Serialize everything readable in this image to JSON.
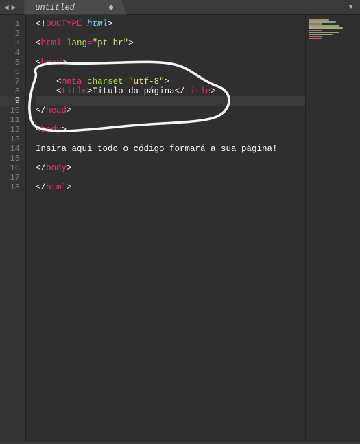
{
  "tab": {
    "title": "untitled",
    "dirty": true
  },
  "nav": {
    "back": "◀",
    "forward": "▶",
    "menu": "▼"
  },
  "gutter_lines": [
    "1",
    "2",
    "3",
    "4",
    "5",
    "6",
    "7",
    "8",
    "9",
    "10",
    "11",
    "12",
    "13",
    "14",
    "15",
    "16",
    "17",
    "18"
  ],
  "code": {
    "l1": {
      "a": "<!",
      "b": "DOCTYPE",
      "c": " ",
      "d": "html",
      "e": ">"
    },
    "l3": {
      "a": "<",
      "b": "html",
      "c": " ",
      "d": "lang",
      "e": "=",
      "f": "\"pt-br\"",
      "g": ">"
    },
    "l5": {
      "a": "<",
      "b": "head",
      "c": ">"
    },
    "l7": {
      "pad": "    ",
      "a": "<",
      "b": "meta",
      "c": " ",
      "d": "charset",
      "e": "=",
      "f": "\"utf-8\"",
      "g": ">"
    },
    "l8": {
      "pad": "    ",
      "a": "<",
      "b": "title",
      "c": ">",
      "d": "Título da página",
      "e": "</",
      "f": "title",
      "g": ">"
    },
    "l10": {
      "a": "</",
      "b": "head",
      "c": ">"
    },
    "l12": {
      "a": "<",
      "b": "body",
      "c": ">"
    },
    "l14": {
      "a": "Insira aqui todo o código formará a sua página!"
    },
    "l16": {
      "a": "</",
      "b": "body",
      "c": ">"
    },
    "l18": {
      "a": "</",
      "b": "html",
      "c": ">"
    }
  }
}
